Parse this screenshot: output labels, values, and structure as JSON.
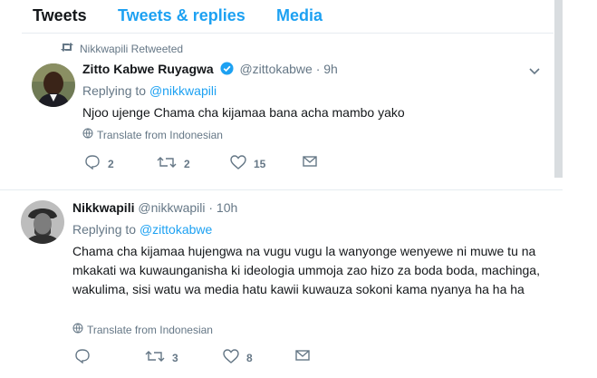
{
  "tabs": [
    {
      "label": "Tweets"
    },
    {
      "label": "Tweets & replies"
    },
    {
      "label": "Media"
    }
  ],
  "tweets": [
    {
      "retweet_label": "Nikkwapili Retweeted",
      "author_name": "Zitto Kabwe Ruyagwa",
      "author_handle": "@zittokabwe",
      "time": "· 9h",
      "replying_to_prefix": "Replying to ",
      "replying_to_handle": "@nikkwapili",
      "text": "Njoo ujenge Chama cha kijamaa bana acha mambo yako",
      "translate": "Translate from Indonesian",
      "replies": "2",
      "retweets": "2",
      "likes": "15"
    },
    {
      "author_name": "Nikkwapili",
      "author_handle": "@nikkwapili",
      "time": "· 10h",
      "replying_to_prefix": "Replying to ",
      "replying_to_handle": "@zittokabwe",
      "text": "Chama cha kijamaa hujengwa na vugu vugu la wanyonge wenyewe ni muwe tu na mkakati wa kuwaunganisha ki ideologia ummoja zao hizo za boda boda, machinga, wakulima, sisi watu wa media hatu kawii kuwauza sokoni kama nyanya ha ha ha",
      "translate": "Translate from Indonesian",
      "replies": "",
      "retweets": "3",
      "likes": "8"
    }
  ],
  "colors": {
    "accent": "#1da1f2",
    "muted": "#657786",
    "text": "#14171a",
    "divider": "#e6ecf0"
  }
}
